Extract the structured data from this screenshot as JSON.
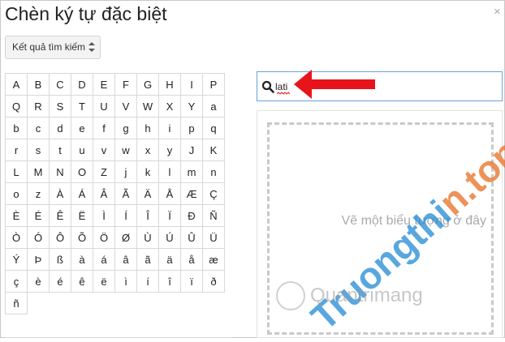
{
  "dialog": {
    "title": "Chèn ký tự đặc biệt",
    "close_glyph": "×"
  },
  "dropdown": {
    "selected": "Kết quả tìm kiếm"
  },
  "characters": [
    "A",
    "B",
    "C",
    "D",
    "E",
    "F",
    "G",
    "H",
    "I",
    "P",
    "Q",
    "R",
    "S",
    "T",
    "U",
    "V",
    "W",
    "X",
    "Y",
    "a",
    "b",
    "c",
    "d",
    "e",
    "f",
    "g",
    "h",
    "i",
    "p",
    "q",
    "r",
    "s",
    "t",
    "u",
    "v",
    "w",
    "x",
    "y",
    "J",
    "K",
    "L",
    "M",
    "N",
    "O",
    "Z",
    "j",
    "k",
    "l",
    "m",
    "n",
    "o",
    "z",
    "À",
    "Á",
    "Â",
    "Ã",
    "Ä",
    "Å",
    "Æ",
    "Ç",
    "È",
    "É",
    "Ê",
    "Ë",
    "Ì",
    "Í",
    "Î",
    "Ï",
    "Ð",
    "Ñ",
    "Ò",
    "Ó",
    "Ô",
    "Õ",
    "Ö",
    "Ø",
    "Ù",
    "Ú",
    "Û",
    "Ü",
    "Ý",
    "Þ",
    "ß",
    "à",
    "á",
    "â",
    "ã",
    "ä",
    "å",
    "æ",
    "ç",
    "è",
    "é",
    "ê",
    "ë",
    "ì",
    "í",
    "î",
    "ï",
    "ð",
    "ñ"
  ],
  "search": {
    "value": "lati"
  },
  "draw_panel": {
    "hint": "Vẽ một biểu tượng ở đây"
  },
  "watermark": {
    "site_part1": "Truongthi",
    "site_part2": "n.top",
    "logo_text": "Quantrimang"
  },
  "colors": {
    "arrow": "#e8141b",
    "search_border": "#6aa2e0",
    "wm_blue": "#2a8fd6",
    "wm_orange": "#e9742b"
  }
}
